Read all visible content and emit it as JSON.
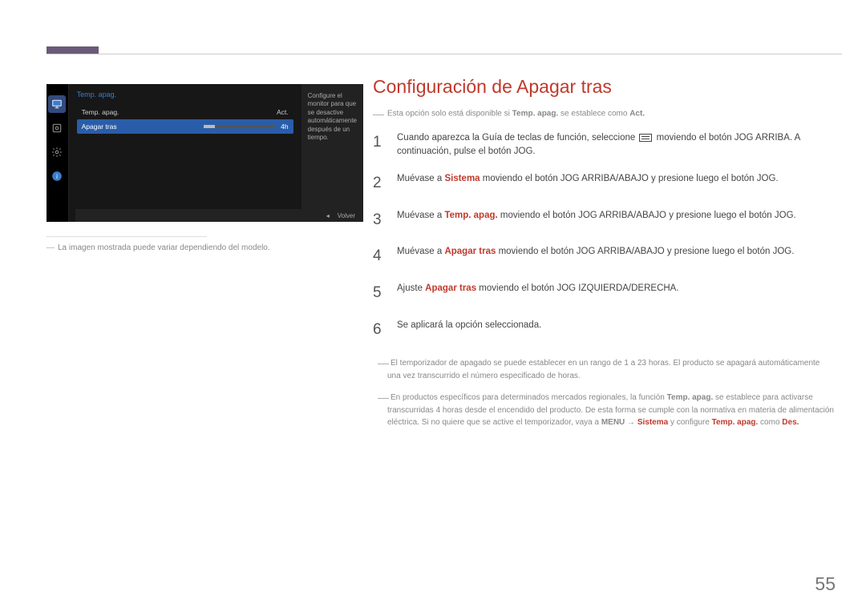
{
  "osd": {
    "title": "Temp. apag.",
    "rows": [
      {
        "label": "Temp. apag.",
        "value": "Act."
      },
      {
        "label": "Apagar tras",
        "value": "4h",
        "selected": true
      }
    ],
    "sideText": "Configure el monitor para que se desactive automáticamente después de un tiempo.",
    "backLabel": "Volver"
  },
  "caption": "La imagen mostrada puede variar dependiendo del modelo.",
  "heading": "Configuración de Apagar tras",
  "topNote": {
    "pre": "Esta opción solo está disponible si ",
    "b1": "Temp. apag.",
    "mid": " se establece como ",
    "b2": "Act."
  },
  "steps": {
    "s1a": "Cuando aparezca la Guía de teclas de función, seleccione ",
    "s1b": " moviendo el botón JOG ARRIBA. A continuación, pulse el botón JOG.",
    "s2a": "Muévase a ",
    "s2b": "Sistema",
    "s2c": " moviendo el botón JOG ARRIBA/ABAJO y presione luego el botón JOG.",
    "s3a": "Muévase a ",
    "s3b": "Temp. apag.",
    "s3c": " moviendo el botón JOG ARRIBA/ABAJO y presione luego el botón JOG.",
    "s4a": "Muévase a ",
    "s4b": "Apagar tras",
    "s4c": " moviendo el botón JOG ARRIBA/ABAJO y presione luego el botón JOG.",
    "s5a": "Ajuste ",
    "s5b": "Apagar tras",
    "s5c": " moviendo el botón JOG IZQUIERDA/DERECHA.",
    "s6": "Se aplicará la opción seleccionada."
  },
  "foot1": "El temporizador de apagado se puede establecer en un rango de 1 a 23 horas. El producto se apagará automáticamente una vez transcurrido el número especificado de horas.",
  "foot2": {
    "a": "En productos específicos para determinados mercados regionales, la función ",
    "b": "Temp. apag.",
    "c": " se establece para activarse transcurridas 4 horas desde el encendido del producto. De esta forma se cumple con la normativa en materia de alimentación eléctrica. Si no quiere que se active el temporizador, vaya a ",
    "d": "MENU",
    "e": " → ",
    "f": "Sistema",
    "g": " y configure ",
    "h": "Temp. apag.",
    "i": " como ",
    "j": "Des."
  },
  "pageNum": "55"
}
